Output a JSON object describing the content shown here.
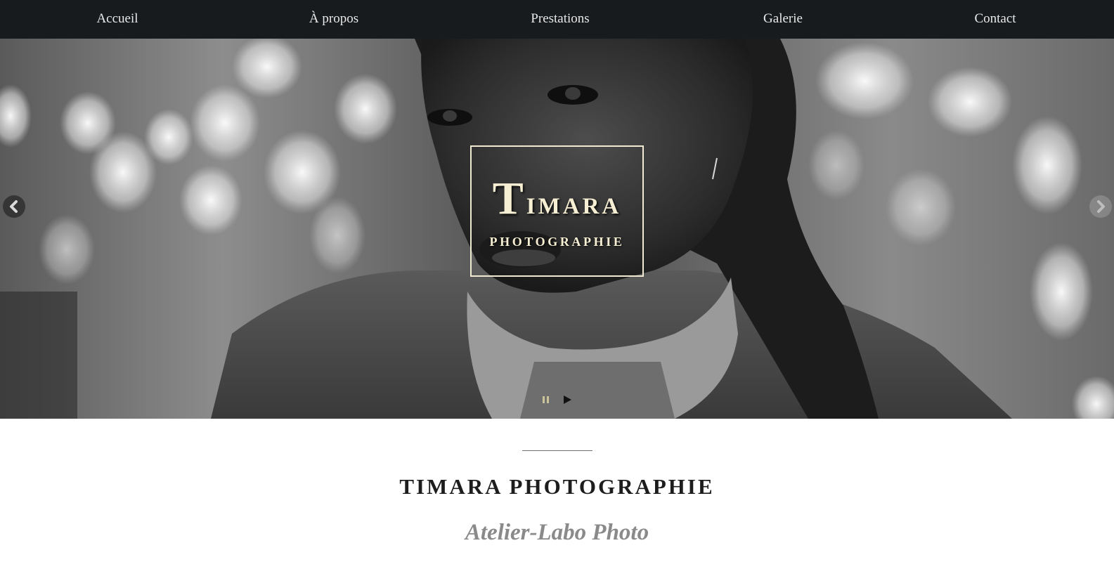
{
  "nav": {
    "items": [
      {
        "label": "Accueil"
      },
      {
        "label": "À propos"
      },
      {
        "label": "Prestations"
      },
      {
        "label": "Galerie"
      },
      {
        "label": "Contact"
      }
    ]
  },
  "hero": {
    "logo": {
      "title_initial": "T",
      "title_rest": "IMARA",
      "subtitle": "PHOTOGRAPHIE"
    },
    "icons": {
      "prev": "chevron-left-icon",
      "next": "chevron-right-icon",
      "pause": "pause-icon",
      "play": "play-icon"
    }
  },
  "content": {
    "title": "TIMARA PHOTOGRAPHIE",
    "subtitle": "Atelier-Labo Photo"
  },
  "colors": {
    "nav_background": "#181b1e",
    "nav_text": "#e9e9e9",
    "logo_accent": "#f7efd3",
    "title_text": "#1d1d1d",
    "subtitle_text": "#8a8a8a"
  }
}
